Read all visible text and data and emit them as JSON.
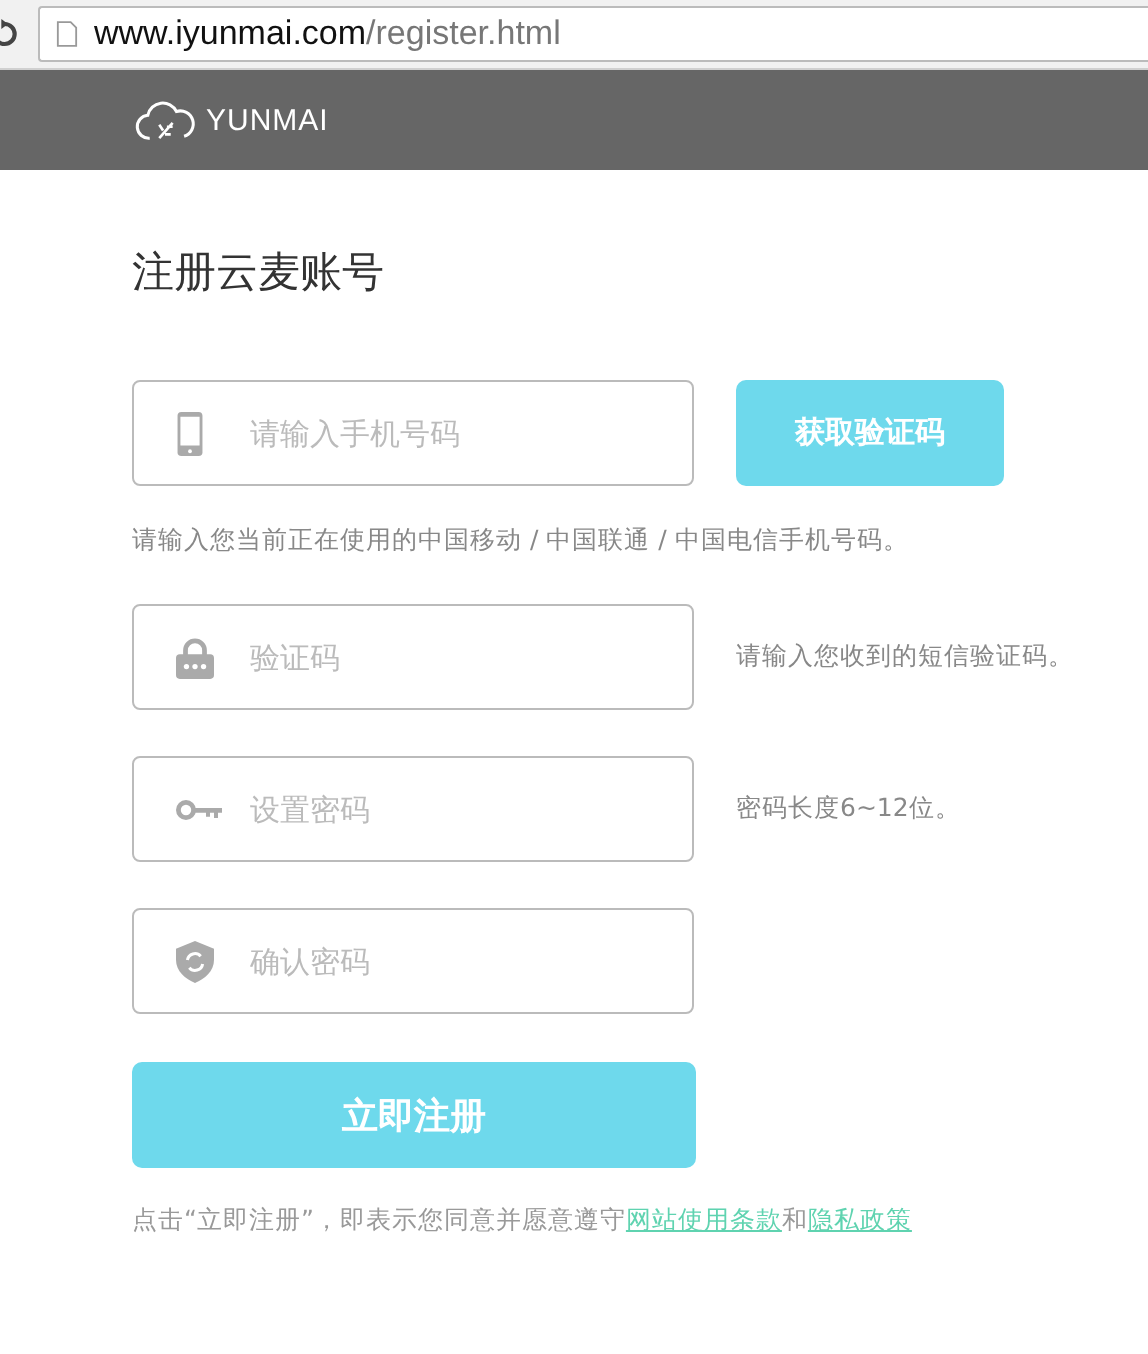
{
  "address_bar": {
    "host": "www.iyunmai.com",
    "path": "/register.html"
  },
  "header": {
    "logo_text": "YUNMAI"
  },
  "title": "注册云麦账号",
  "fields": [
    {
      "kind": "phone",
      "placeholder": "请输入手机号码",
      "button": "获取验证码",
      "hint": "请输入您当前正在使用的中国移动 / 中国联通 / 中国电信手机号码。"
    },
    {
      "kind": "code",
      "placeholder": "验证码",
      "note": "请输入您收到的短信验证码。"
    },
    {
      "kind": "password",
      "placeholder": "设置密码",
      "note": "密码长度6~12位。"
    },
    {
      "kind": "confirm",
      "placeholder": "确认密码"
    }
  ],
  "submit": "立即注册",
  "terms": {
    "text": "点击“立即注册”，即表示您同意并愿意遵守",
    "links": [
      "网站使用条款",
      "隐私政策"
    ],
    "joiner": "和"
  }
}
